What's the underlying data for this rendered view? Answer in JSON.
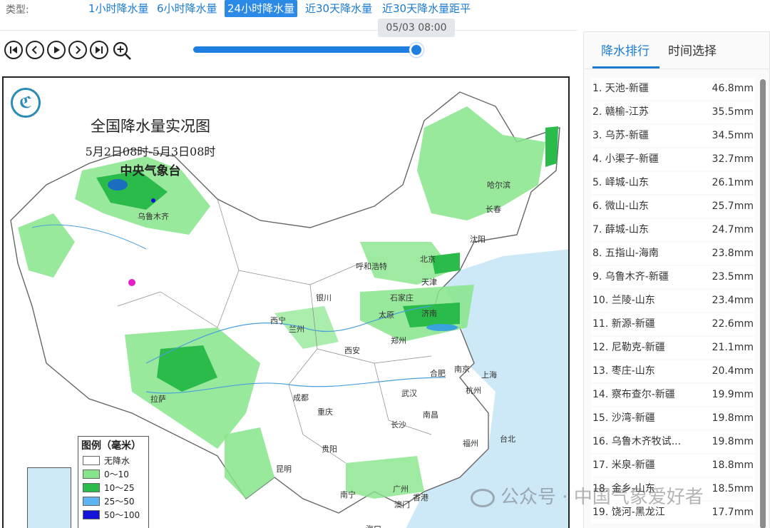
{
  "typebar": {
    "label": "类型:",
    "buttons": [
      {
        "label": "1小时降水量",
        "active": false
      },
      {
        "label": "6小时降水量",
        "active": false
      },
      {
        "label": "24小时降水量",
        "active": true
      },
      {
        "label": "近30天降水量",
        "active": false
      },
      {
        "label": "近30天降水量距平",
        "active": false
      }
    ]
  },
  "slider": {
    "tooltip": "05/03 08:00",
    "position_fraction": 1.0
  },
  "map": {
    "title": "全国降水量实况图",
    "subtitle": "5月2日08时-5月3日08时",
    "agency": "中央气象台",
    "cities": [
      "乌鲁木齐",
      "哈尔滨",
      "长春",
      "沈阳",
      "北京",
      "天津",
      "呼和浩特",
      "石家庄",
      "太原",
      "济南",
      "银川",
      "西宁",
      "兰州",
      "郑州",
      "西安",
      "合肥",
      "南京",
      "上海",
      "杭州",
      "拉萨",
      "成都",
      "重庆",
      "武汉",
      "南昌",
      "长沙",
      "贵阳",
      "昆明",
      "福州",
      "台北",
      "南宁",
      "广州",
      "澳门",
      "香港",
      "海口"
    ],
    "legend": {
      "title": "图例（毫米）",
      "items": [
        {
          "label": "无降水",
          "color": "#ffffff"
        },
        {
          "label": "0～10",
          "color": "#86e58a"
        },
        {
          "label": "10～25",
          "color": "#2bbb4a"
        },
        {
          "label": "25～50",
          "color": "#5fb3f0"
        },
        {
          "label": "50～100",
          "color": "#1414d8"
        }
      ]
    }
  },
  "panel": {
    "tabs": [
      "降水排行",
      "时间选择"
    ],
    "ranking": [
      {
        "name": "1. 天池-新疆",
        "value": "46.8mm"
      },
      {
        "name": "2. 赣榆-江苏",
        "value": "35.5mm"
      },
      {
        "name": "3. 乌苏-新疆",
        "value": "34.5mm"
      },
      {
        "name": "4. 小渠子-新疆",
        "value": "32.7mm"
      },
      {
        "name": "5. 峄城-山东",
        "value": "26.1mm"
      },
      {
        "name": "6. 微山-山东",
        "value": "25.7mm"
      },
      {
        "name": "7. 薛城-山东",
        "value": "24.7mm"
      },
      {
        "name": "8. 五指山-海南",
        "value": "23.8mm"
      },
      {
        "name": "9. 乌鲁木齐-新疆",
        "value": "23.5mm"
      },
      {
        "name": "10. 兰陵-山东",
        "value": "23.4mm"
      },
      {
        "name": "11. 新源-新疆",
        "value": "22.6mm"
      },
      {
        "name": "12. 尼勒克-新疆",
        "value": "21.1mm"
      },
      {
        "name": "13. 枣庄-山东",
        "value": "20.4mm"
      },
      {
        "name": "14. 察布查尔-新疆",
        "value": "19.9mm"
      },
      {
        "name": "15. 沙湾-新疆",
        "value": "19.8mm"
      },
      {
        "name": "16. 乌鲁木齐牧试...",
        "value": "19.8mm"
      },
      {
        "name": "17. 米泉-新疆",
        "value": "18.8mm"
      },
      {
        "name": "18. 金乡-山东",
        "value": "18.5mm"
      },
      {
        "name": "19. 饶河-黑龙江",
        "value": "17.7mm"
      }
    ]
  },
  "watermark": "公众号 · 中国气象爱好者",
  "colors": {
    "accent": "#1a7bd1",
    "slider": "#1e7fe0",
    "rain_light": "#86e58a",
    "rain_mid": "#2bbb4a"
  }
}
